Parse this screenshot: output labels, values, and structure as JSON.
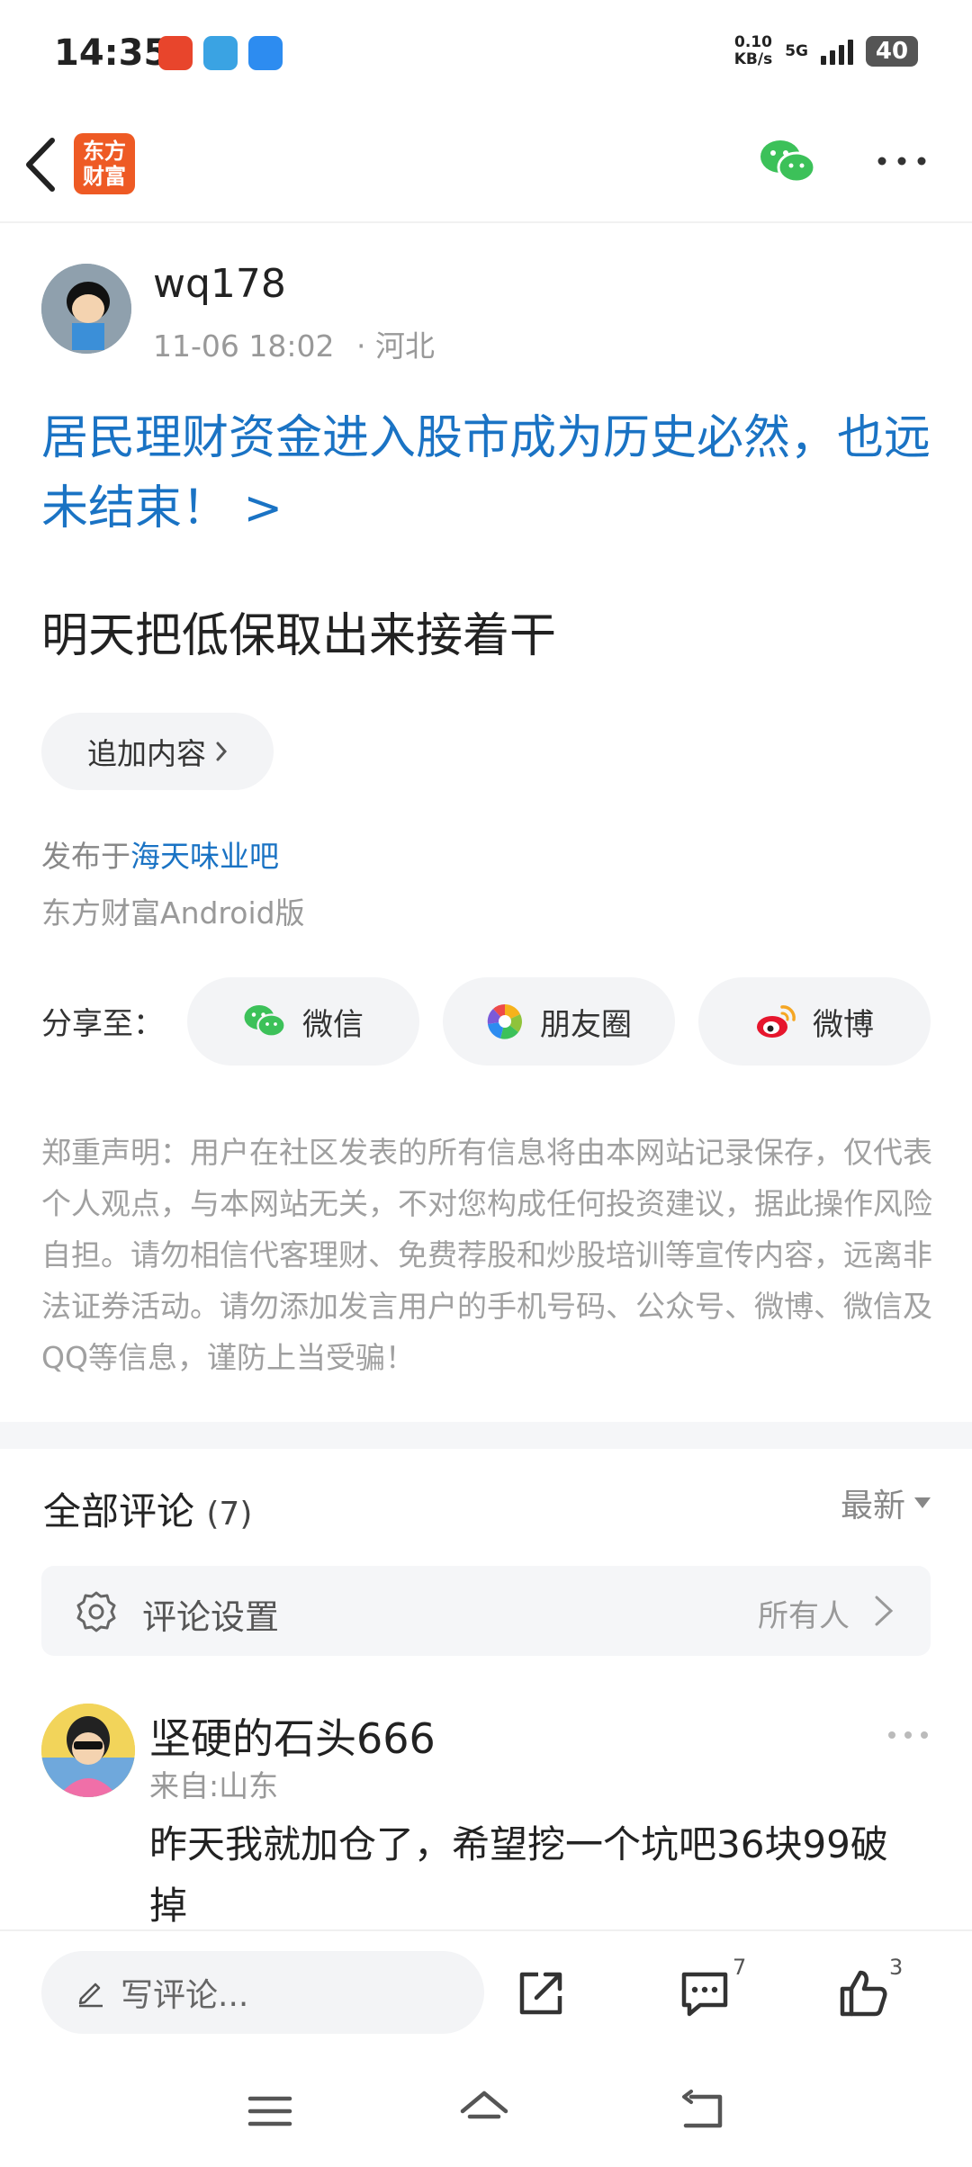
{
  "status_bar": {
    "time": "14:35",
    "net_speed_value": "0.10",
    "net_speed_unit": "KB/s",
    "network": "5G",
    "battery": "40"
  },
  "header": {
    "logo_line1": "东方",
    "logo_line2": "财富",
    "back_icon": "chevron-left-icon",
    "share_icon": "wechat-icon",
    "more_icon": "more-horizontal-icon"
  },
  "post": {
    "author": "wq178",
    "timestamp": "11-06 18:02",
    "location": "· 河北",
    "title": "居民理财资金进入股市成为历史必然，也远未结束！ >",
    "body": "明天把低保取出来接着干",
    "add_content_label": "追加内容",
    "published_prefix": "发布于",
    "forum_link": "海天味业吧",
    "client": "东方财富Android版"
  },
  "share": {
    "label": "分享至：",
    "targets": [
      {
        "label": "微信",
        "icon": "wechat-icon"
      },
      {
        "label": "朋友圈",
        "icon": "moments-icon"
      },
      {
        "label": "微博",
        "icon": "weibo-icon"
      }
    ]
  },
  "disclaimer": "郑重声明：用户在社区发表的所有信息将由本网站记录保存，仅代表个人观点，与本网站无关，不对您构成任何投资建议，据此操作风险自担。请勿相信代客理财、免费荐股和炒股培训等宣传内容，远离非法证券活动。请勿添加发言用户的手机号码、公众号、微博、微信及QQ等信息，谨防上当受骗！",
  "comments": {
    "title": "全部评论",
    "count": "(7)",
    "sort_label": "最新",
    "settings_label": "评论设置",
    "settings_value": "所有人",
    "items": [
      {
        "name": "坚硬的石头666",
        "location": "来自:山东",
        "text": "昨天我就加仓了，希望挖一个坑吧36块99破掉"
      }
    ]
  },
  "bottom_bar": {
    "input_placeholder": "写评论...",
    "comment_count": "7",
    "like_count": "3"
  },
  "colors": {
    "link_blue": "#1a73c4",
    "brand_orange": "#ee5a24",
    "wechat_green": "#3cc159"
  }
}
